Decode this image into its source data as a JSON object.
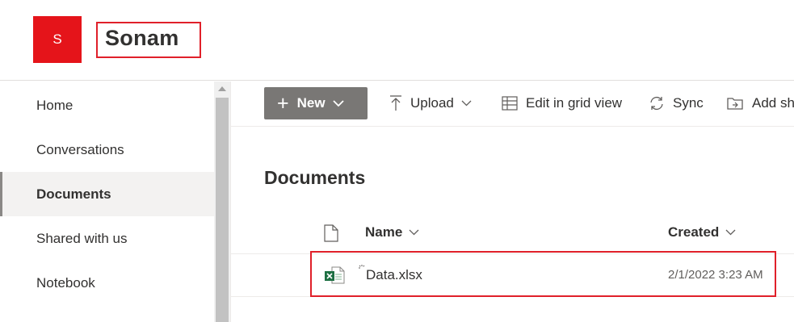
{
  "site": {
    "logo_letter": "S",
    "title": "Sonam"
  },
  "nav": {
    "items": [
      {
        "label": "Home"
      },
      {
        "label": "Conversations"
      },
      {
        "label": "Documents"
      },
      {
        "label": "Shared with us"
      },
      {
        "label": "Notebook"
      }
    ],
    "active": "Documents"
  },
  "commandbar": {
    "new_label": "New",
    "upload_label": "Upload",
    "grid_label": "Edit in grid view",
    "sync_label": "Sync",
    "addshortcut_label": "Add sh"
  },
  "library": {
    "title": "Documents",
    "columns": {
      "name": "Name",
      "created": "Created"
    },
    "rows": [
      {
        "name": "Data.xlsx",
        "created": "2/1/2022 3:23 AM",
        "file_type_icon": "excel-icon"
      }
    ]
  },
  "colors": {
    "brand": "#e5141a",
    "highlight": "#e0202a",
    "new_button": "#797775",
    "excel_green": "#1d6f42"
  }
}
